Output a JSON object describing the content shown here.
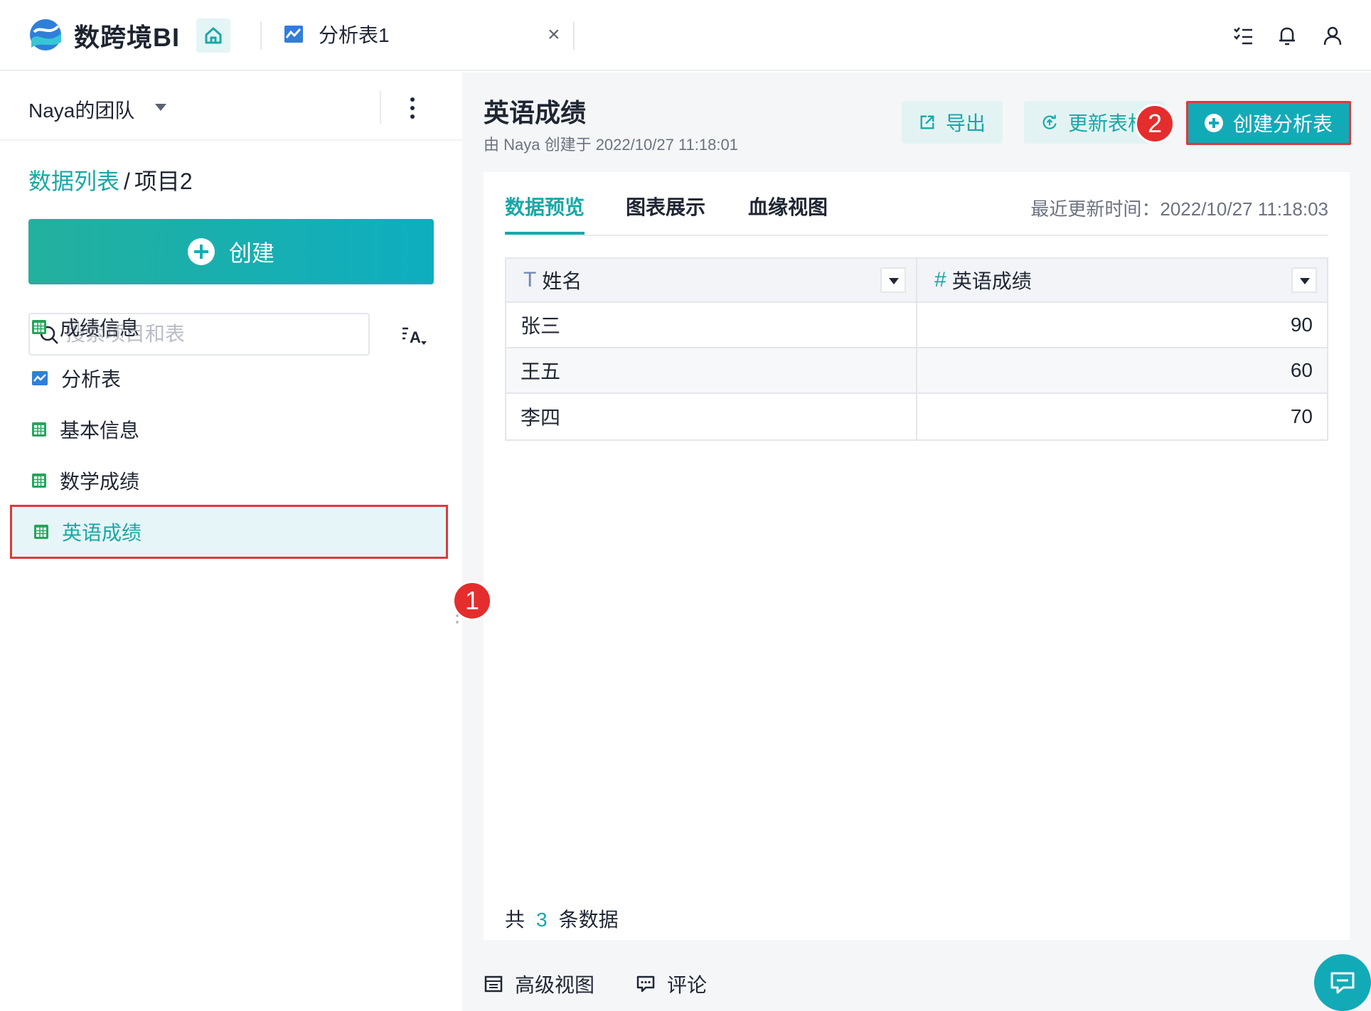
{
  "app": {
    "name": "数跨境BI"
  },
  "tabs": [
    {
      "label": "分析表1",
      "icon": "chart-icon"
    }
  ],
  "colors": {
    "accent": "#1aa7a7",
    "callout": "#e52d2d",
    "highlight_border": "#e0383b"
  },
  "sidebar": {
    "team": "Naya的团队",
    "breadcrumb": {
      "root": "数据列表",
      "separator": "/",
      "current": "项目2"
    },
    "create_label": "创建",
    "search_placeholder": "搜索项目和表",
    "items": [
      {
        "label": "成绩信息",
        "icon": "table-icon",
        "active": false
      },
      {
        "label": "分析表",
        "icon": "chart-icon",
        "active": false
      },
      {
        "label": "基本信息",
        "icon": "table-icon",
        "active": false
      },
      {
        "label": "数学成绩",
        "icon": "table-icon",
        "active": false
      },
      {
        "label": "英语成绩",
        "icon": "table-icon",
        "active": true
      }
    ]
  },
  "callouts": [
    "1",
    "2"
  ],
  "main": {
    "title": "英语成绩",
    "subtitle": "由 Naya 创建于 2022/10/27 11:18:01",
    "actions": {
      "export": "导出",
      "update": "更新表格",
      "create_analysis": "创建分析表"
    },
    "tabs": [
      "数据预览",
      "图表展示",
      "血缘视图"
    ],
    "updated": "最近更新时间：2022/10/27 11:18:03",
    "table": {
      "columns": [
        {
          "type": "T",
          "name": "姓名"
        },
        {
          "type": "#",
          "name": "英语成绩"
        }
      ],
      "rows": [
        [
          "张三",
          "90"
        ],
        [
          "王五",
          "60"
        ],
        [
          "李四",
          "70"
        ]
      ]
    },
    "count": {
      "prefix": "共",
      "value": "3",
      "suffix": "条数据"
    },
    "bottom": {
      "advanced_view": "高级视图",
      "comment": "评论"
    }
  }
}
